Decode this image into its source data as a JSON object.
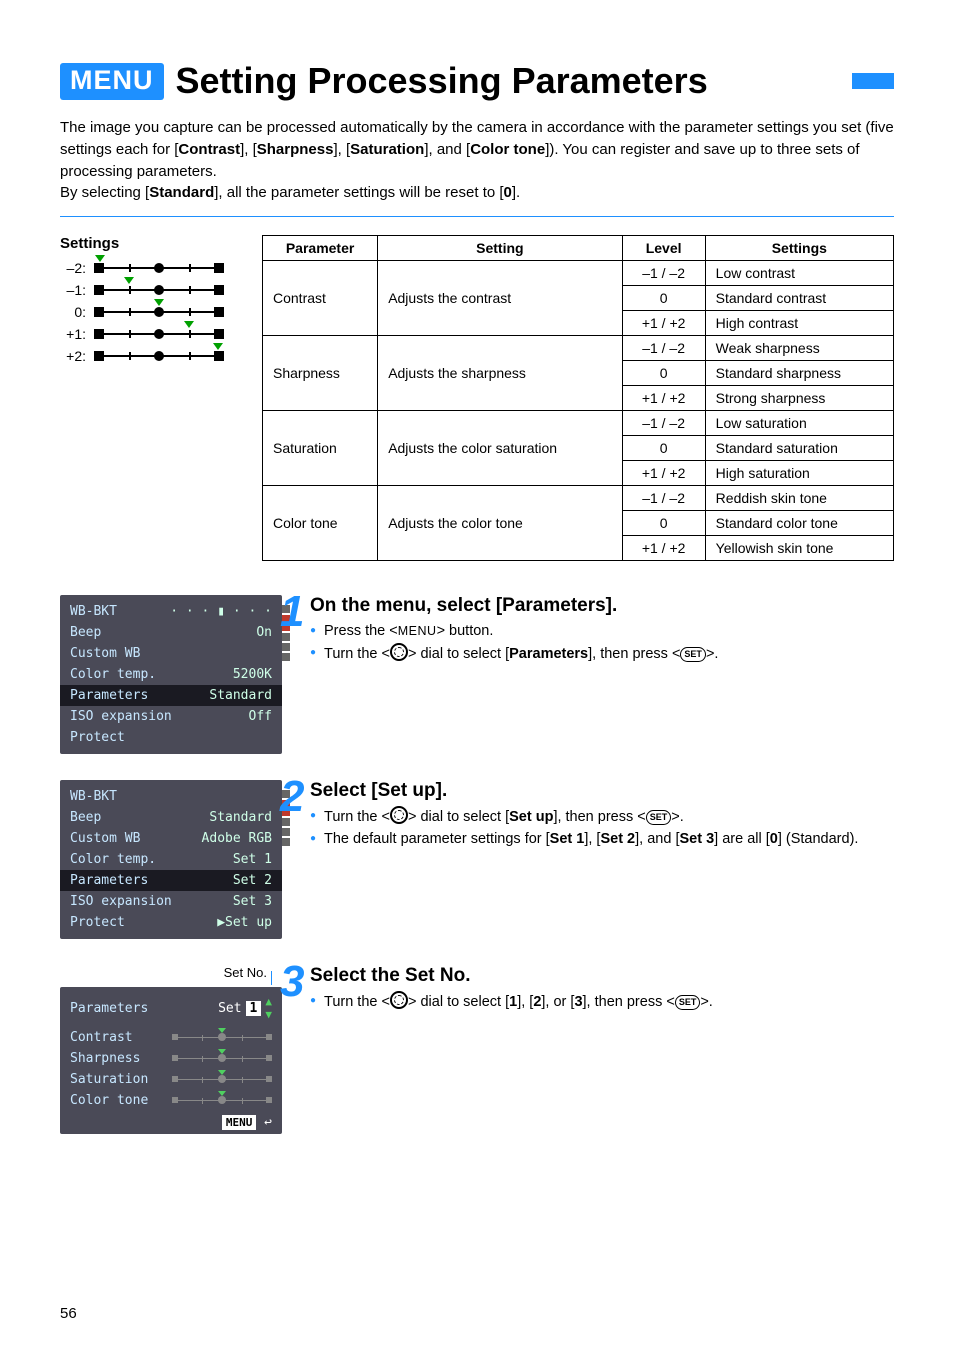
{
  "page_number": "56",
  "title": {
    "menu_badge": "MENU",
    "text": "Setting Processing Parameters"
  },
  "intro": {
    "line1_pre": "The image you capture can be processed automatically by the camera in accordance with the parameter settings you set (five settings each for [",
    "b1": "Contrast",
    "mid1": "], [",
    "b2": "Sharpness",
    "mid2": "], [",
    "b3": "Saturation",
    "mid3": "], and [",
    "b4": "Color tone",
    "line1_post": "]). You can register and save up to three sets of processing parameters.",
    "line2_pre": "By selecting [",
    "b5": "Standard",
    "line2_mid": "], all the parameter settings will be reset to [",
    "b6": "0",
    "line2_post": "]."
  },
  "settings_label": "Settings",
  "sliders": [
    {
      "label": "–2:",
      "pos": 6
    },
    {
      "label": "–1:",
      "pos": 35
    },
    {
      "label": "0:",
      "pos": 65
    },
    {
      "label": "+1:",
      "pos": 95
    },
    {
      "label": "+2:",
      "pos": 124
    }
  ],
  "table": {
    "headers": [
      "Parameter",
      "Setting",
      "Level",
      "Settings"
    ],
    "rows": [
      {
        "param": "Contrast",
        "setting": "Adjusts the contrast",
        "levels": [
          {
            "lvl": "–1 / –2",
            "desc": "Low contrast"
          },
          {
            "lvl": "0",
            "desc": "Standard contrast"
          },
          {
            "lvl": "+1 / +2",
            "desc": "High contrast"
          }
        ]
      },
      {
        "param": "Sharpness",
        "setting": "Adjusts the sharpness",
        "levels": [
          {
            "lvl": "–1 / –2",
            "desc": "Weak sharpness"
          },
          {
            "lvl": "0",
            "desc": "Standard sharpness"
          },
          {
            "lvl": "+1 / +2",
            "desc": "Strong sharpness"
          }
        ]
      },
      {
        "param": "Saturation",
        "setting": "Adjusts the color saturation",
        "levels": [
          {
            "lvl": "–1 / –2",
            "desc": "Low saturation"
          },
          {
            "lvl": "0",
            "desc": "Standard saturation"
          },
          {
            "lvl": "+1 / +2",
            "desc": "High saturation"
          }
        ]
      },
      {
        "param": "Color tone",
        "setting": "Adjusts the color tone",
        "levels": [
          {
            "lvl": "–1 / –2",
            "desc": "Reddish skin tone"
          },
          {
            "lvl": "0",
            "desc": "Standard color tone"
          },
          {
            "lvl": "+1 / +2",
            "desc": "Yellowish skin tone"
          }
        ]
      }
    ]
  },
  "lcd1": {
    "rows": [
      {
        "k": "WB-BKT",
        "v": "· · · ▮ · · ·"
      },
      {
        "k": "Beep",
        "v": "On"
      },
      {
        "k": "Custom WB",
        "v": ""
      },
      {
        "k": "Color temp.",
        "v": "5200K"
      },
      {
        "k": "Parameters",
        "v": "Standard",
        "sel": true
      },
      {
        "k": "ISO expansion",
        "v": "Off"
      },
      {
        "k": "Protect",
        "v": ""
      }
    ]
  },
  "step1": {
    "num": "1",
    "title": "On the menu, select [Parameters].",
    "b1_pre": "Press the <",
    "b1_menu": "MENU",
    "b1_post": "> button.",
    "b2_pre": "Turn the <",
    "b2_mid": "> dial to select [",
    "b2_bold": "Parameters",
    "b2_post": "], then press <",
    "b2_set": "SET",
    "b2_end": ">."
  },
  "lcd2": {
    "rows": [
      {
        "k": "WB-BKT",
        "v": ""
      },
      {
        "k": "Beep",
        "v": "Standard"
      },
      {
        "k": "Custom WB",
        "v": "Adobe RGB"
      },
      {
        "k": "Color temp.",
        "v": "Set 1"
      },
      {
        "k": "Parameters",
        "v": "Set 2",
        "sel": true
      },
      {
        "k": "ISO expansion",
        "v": "Set 3"
      },
      {
        "k": "Protect",
        "v": "▶Set up"
      }
    ]
  },
  "step2": {
    "num": "2",
    "title": "Select [Set up].",
    "b1_pre": "Turn the <",
    "b1_mid": "> dial to select [",
    "b1_bold": "Set up",
    "b1_post": "], then press <",
    "b1_set": "SET",
    "b1_end": ">.",
    "b2_pre": "The default parameter settings for [",
    "b2_s1": "Set 1",
    "b2_m1": "], [",
    "b2_s2": "Set 2",
    "b2_m2": "], and [",
    "b2_s3": "Set 3",
    "b2_m3": "] are all [",
    "b2_s4": "0",
    "b2_post": "] (Standard)."
  },
  "setno_label": "Set No.",
  "lcd3": {
    "title": "Parameters",
    "set_label": "Set",
    "set_value": "1",
    "rows": [
      "Contrast",
      "Sharpness",
      "Saturation",
      "Color tone"
    ],
    "menu_label": "MENU"
  },
  "step3": {
    "num": "3",
    "title": "Select the Set No.",
    "b1_pre": "Turn the <",
    "b1_mid": "> dial to select [",
    "b1_o1": "1",
    "b1_m1": "], [",
    "b1_o2": "2",
    "b1_m2": "], or [",
    "b1_o3": "3",
    "b1_post": "], then press <",
    "b1_set": "SET",
    "b1_end": ">."
  }
}
